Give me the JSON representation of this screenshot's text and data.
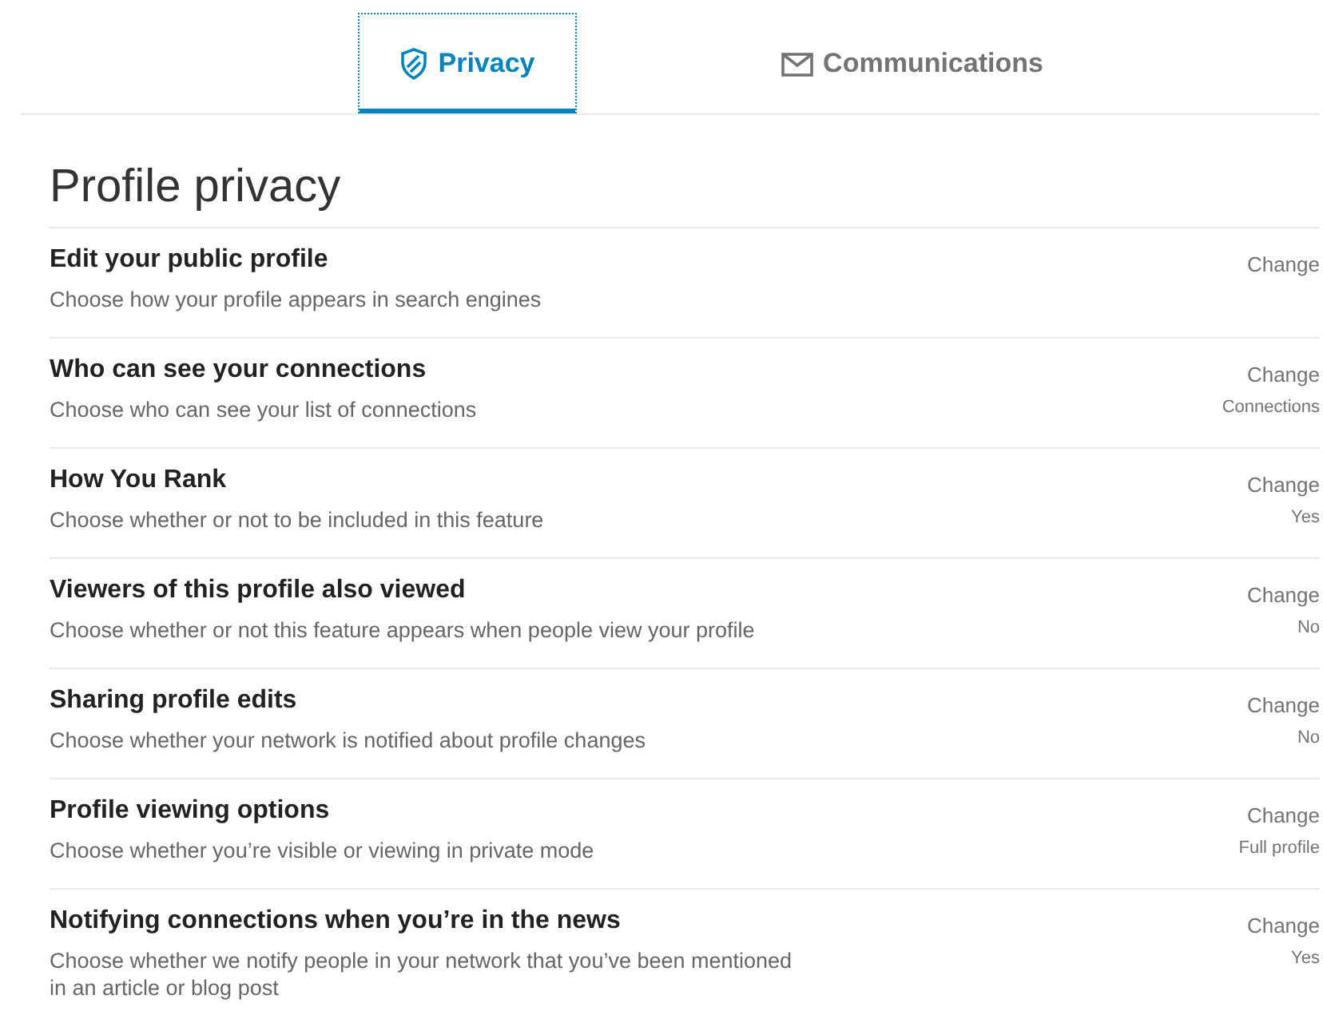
{
  "tabs": [
    {
      "label": "Privacy",
      "selected": true
    },
    {
      "label": "Communications",
      "selected": false
    }
  ],
  "section": {
    "title": "Profile privacy",
    "rows": [
      {
        "title": "Edit your public profile",
        "description": "Choose how your profile appears in search engines",
        "action": "Change"
      },
      {
        "title": "Who can see your connections",
        "description": "Choose who can see your list of connections",
        "action": "Change",
        "value": "Connections"
      },
      {
        "title": "How You Rank",
        "description": "Choose whether or not to be included in this feature",
        "action": "Change",
        "value": "Yes"
      },
      {
        "title": "Viewers of this profile also viewed",
        "description": "Choose whether or not this feature appears when people view your profile",
        "action": "Change",
        "value": "No"
      },
      {
        "title": "Sharing profile edits",
        "description": "Choose whether your network is notified about profile changes",
        "action": "Change",
        "value": "No"
      },
      {
        "title": "Profile viewing options",
        "description": "Choose whether you’re visible or viewing in private mode",
        "action": "Change",
        "value": "Full profile"
      },
      {
        "title": "Notifying connections when you’re in the news",
        "description": "Choose whether we notify people in your network that you’ve been mentioned in an article or blog post",
        "action": "Change",
        "value": "Yes"
      }
    ]
  }
}
